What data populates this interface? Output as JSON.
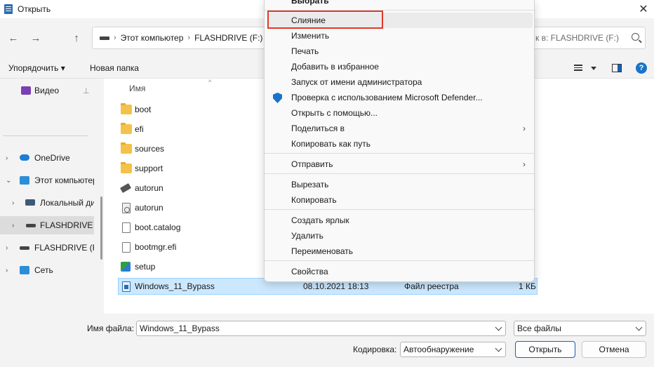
{
  "window": {
    "title": "Открыть",
    "close_glyph": "✕"
  },
  "nav": {
    "back_glyph": "←",
    "forward_glyph": "→",
    "up_glyph": "↑",
    "address": [
      "Этот компьютер",
      "FLASHDRIVE (F:)"
    ],
    "crumb_sep": "›",
    "search_placeholder": "к в: FLASHDRIVE (F:)"
  },
  "toolbar": {
    "organize": "Упорядочить ▾",
    "new_folder": "Новая папка",
    "help": "?"
  },
  "sidebar": {
    "chevron_right": "›",
    "chevron_down": "⌄",
    "items": [
      {
        "label": "Видео",
        "pinned": true
      },
      {
        "label": "OneDrive"
      },
      {
        "label": "Этот компьютер"
      },
      {
        "label": "Локальный диск"
      },
      {
        "label": "FLASHDRIVE (F:)"
      },
      {
        "label": "FLASHDRIVE (F:)"
      },
      {
        "label": "Сеть"
      }
    ]
  },
  "files": {
    "column_name": "Имя",
    "sort_glyph": "^",
    "items": [
      {
        "name": "boot",
        "type": "folder"
      },
      {
        "name": "efi",
        "type": "folder"
      },
      {
        "name": "sources",
        "type": "folder"
      },
      {
        "name": "support",
        "type": "folder"
      },
      {
        "name": "autorun",
        "type": "autorun"
      },
      {
        "name": "autorun",
        "type": "config"
      },
      {
        "name": "boot.catalog",
        "type": "file"
      },
      {
        "name": "bootmgr.efi",
        "type": "file"
      },
      {
        "name": "setup",
        "type": "setup"
      },
      {
        "name": "Windows_11_Bypass",
        "type": "reg",
        "date": "08.10.2021 18:13",
        "kind": "Файл реестра",
        "size": "1 КБ"
      }
    ]
  },
  "context_menu": {
    "items": [
      {
        "label": "Выбрать",
        "bold": true
      },
      {
        "label": "Слияние",
        "highlighted": true
      },
      {
        "label": "Изменить"
      },
      {
        "label": "Печать"
      },
      {
        "label": "Добавить в избранное"
      },
      {
        "label": "Запуск от имени администратора"
      },
      {
        "label": "Проверка с использованием Microsoft Defender...",
        "icon": "shield-icon"
      },
      {
        "label": "Открыть с помощью..."
      },
      {
        "label": "Поделиться в",
        "submenu": true
      },
      {
        "label": "Копировать как путь"
      },
      {
        "label": "Отправить",
        "submenu": true
      },
      {
        "label": "Вырезать"
      },
      {
        "label": "Копировать"
      },
      {
        "label": "Создать ярлык"
      },
      {
        "label": "Удалить"
      },
      {
        "label": "Переименовать"
      },
      {
        "label": "Свойства"
      }
    ],
    "submenu_glyph": "›"
  },
  "bottom": {
    "filename_label": "Имя файла:",
    "filename_value": "Windows_11_Bypass",
    "filter_value": "Все файлы",
    "encoding_label": "Кодировка:",
    "encoding_value": "Автообнаружение",
    "open_button": "Открыть",
    "cancel_button": "Отмена"
  },
  "colors": {
    "accent": "#1a5fb4",
    "highlight_box": "#e0392b",
    "selection": "#cce8ff"
  }
}
